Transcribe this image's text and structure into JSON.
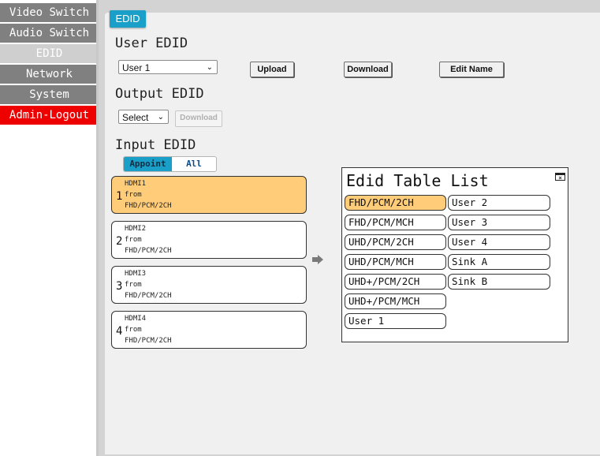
{
  "sidebar": {
    "items": [
      {
        "label": "Video Switch"
      },
      {
        "label": "Audio Switch"
      },
      {
        "label": "EDID"
      },
      {
        "label": "Network"
      },
      {
        "label": "System"
      },
      {
        "label": "Admin-Logout"
      }
    ]
  },
  "main": {
    "tab_label": "EDID",
    "user_edid": {
      "title": "User EDID",
      "select_value": "User 1",
      "upload_label": "Upload",
      "download_label": "Download",
      "edit_name_label": "Edit Name"
    },
    "output_edid": {
      "title": "Output EDID",
      "select_value": "Select",
      "download_label": "Download"
    },
    "input_edid": {
      "title": "Input EDID",
      "toggle": {
        "appoint": "Appoint",
        "all": "All"
      },
      "inputs": [
        {
          "number": "1",
          "name": "HDMI1",
          "from": "from",
          "edid": "FHD/PCM/2CH"
        },
        {
          "number": "2",
          "name": "HDMI2",
          "from": "from",
          "edid": "FHD/PCM/2CH"
        },
        {
          "number": "3",
          "name": "HDMI3",
          "from": "from",
          "edid": "FHD/PCM/2CH"
        },
        {
          "number": "4",
          "name": "HDMI4",
          "from": "from",
          "edid": "FHD/PCM/2CH"
        }
      ]
    },
    "edid_table": {
      "title": "Edid Table List",
      "left_column": [
        "FHD/PCM/2CH",
        "FHD/PCM/MCH",
        "UHD/PCM/2CH",
        "UHD/PCM/MCH",
        "UHD+/PCM/2CH",
        "UHD+/PCM/MCH",
        "User 1"
      ],
      "right_column": [
        "User 2",
        "User 3",
        "User 4",
        "Sink A",
        "Sink B"
      ]
    }
  },
  "colors": {
    "accent": "#1aa0c8",
    "selected": "#ffcd7a",
    "logout": "#ee0000",
    "nav": "#808080"
  }
}
